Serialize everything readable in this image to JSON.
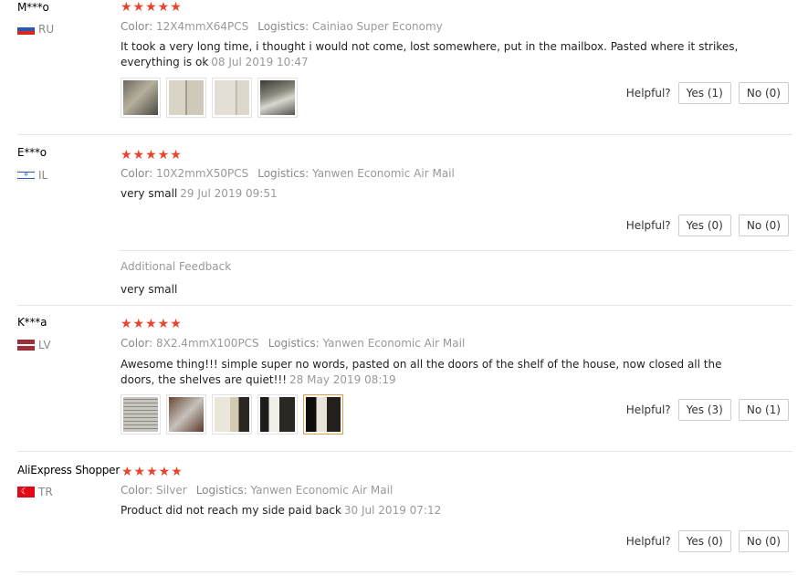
{
  "helpful_label": "Helpful?",
  "star_glyphs": "★★★★★",
  "reviews": [
    {
      "author": "M***o",
      "country": "RU",
      "flag": "ru",
      "color_label": "Color:",
      "color": "12X4mmX64PCS",
      "logistics_label": "Logistics:",
      "logistics": "Cainiao Super Economy",
      "text": "It took a very long time, i thought i would not come, lost somewhere, put in the mailbox. Pasted where it strikes, everything is ok",
      "date": "08 Jul 2019 10:47",
      "yes": "Yes (1)",
      "no": "No (0)",
      "photos": 4
    },
    {
      "author": "E***o",
      "country": "IL",
      "flag": "il",
      "color_label": "Color:",
      "color": "10X2mmX50PCS",
      "logistics_label": "Logistics:",
      "logistics": "Yanwen Economic Air Mail",
      "text": "very small",
      "date": "29 Jul 2019 09:51",
      "yes": "Yes (0)",
      "no": "No (0)",
      "additional_title": "Additional Feedback",
      "additional_text": "very small"
    },
    {
      "author": "K***a",
      "country": "LV",
      "flag": "lv",
      "color_label": "Color:",
      "color": "8X2.4mmX100PCS",
      "logistics_label": "Logistics:",
      "logistics": "Yanwen Economic Air Mail",
      "text": "Awesome thing!!! simple super no words, pasted on all the doors of the shelf of the house, now closed all the doors, the shelves are quiet!!!",
      "date": "28 May 2019 08:19",
      "yes": "Yes (3)",
      "no": "No (1)",
      "photos": 5
    },
    {
      "author": "AliExpress Shopper",
      "country": "TR",
      "flag": "tr",
      "color_label": "Color:",
      "color": "Silver",
      "logistics_label": "Logistics:",
      "logistics": "Yanwen Economic Air Mail",
      "text": "Product did not reach my side paid back",
      "date": "30 Jul 2019 07:12",
      "yes": "Yes (0)",
      "no": "No (0)"
    }
  ],
  "colors": {
    "star": "#e8452c",
    "muted": "#999999",
    "active_thumb_border": "#e59a46"
  }
}
